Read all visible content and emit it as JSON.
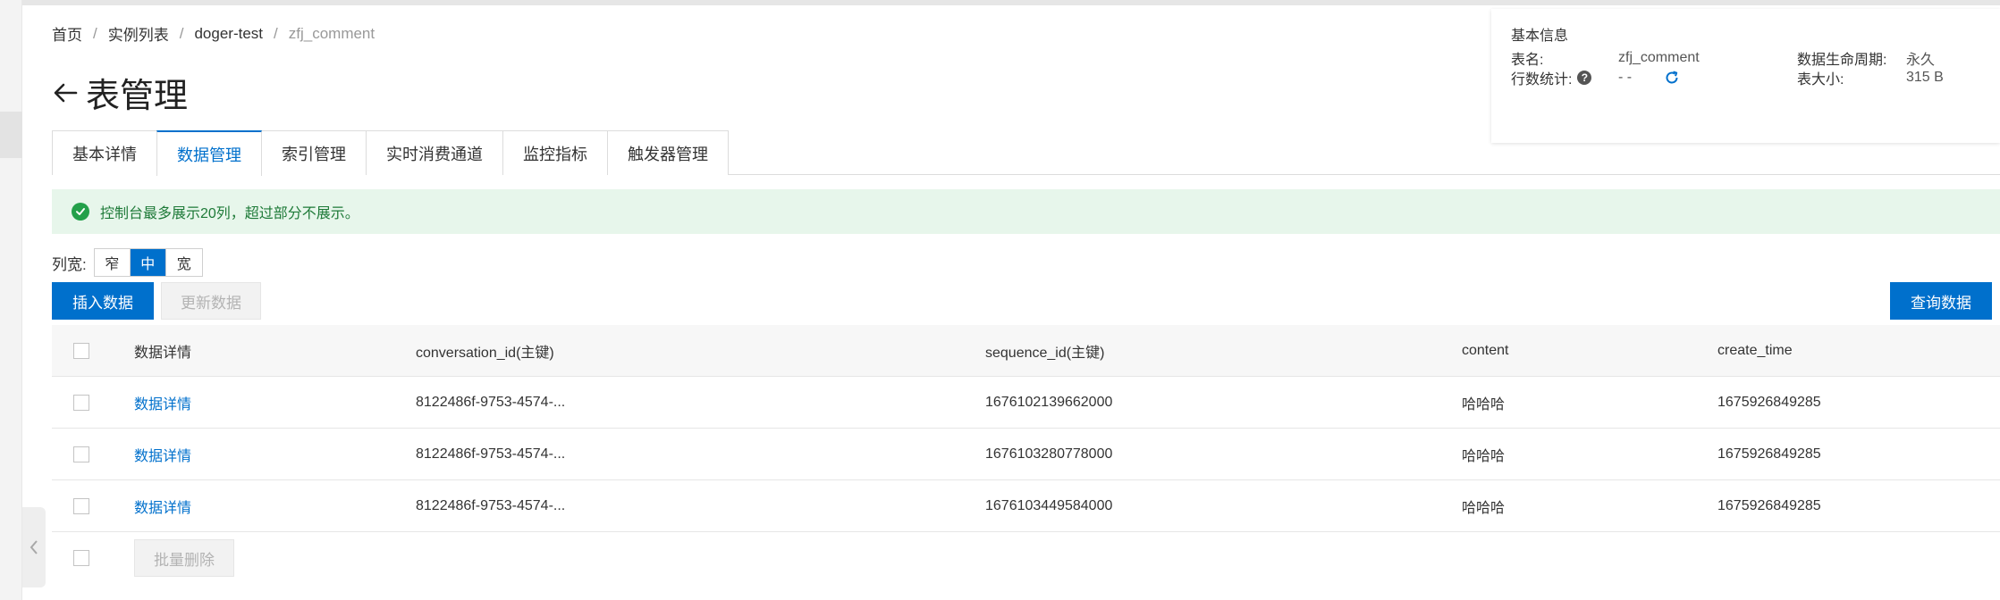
{
  "breadcrumb": {
    "items": [
      "首页",
      "实例列表",
      "doger-test"
    ],
    "separator": "/",
    "current": "zfj_comment"
  },
  "page": {
    "title": "表管理"
  },
  "info_panel": {
    "title": "基本信息",
    "table_name_label": "表名:",
    "table_name_value": "zfj_comment",
    "lifecycle_label": "数据生命周期:",
    "lifecycle_value": "永久",
    "row_count_label": "行数统计:",
    "row_count_value": "- -",
    "size_label": "表大小:",
    "size_value": "315 B"
  },
  "tabs": [
    {
      "label": "基本详情",
      "active": false
    },
    {
      "label": "数据管理",
      "active": true
    },
    {
      "label": "索引管理",
      "active": false
    },
    {
      "label": "实时消费通道",
      "active": false
    },
    {
      "label": "监控指标",
      "active": false
    },
    {
      "label": "触发器管理",
      "active": false
    }
  ],
  "alert": {
    "text": "控制台最多展示20列，超过部分不展示。"
  },
  "column_width": {
    "label": "列宽:",
    "options": [
      "窄",
      "中",
      "宽"
    ],
    "selected": "中"
  },
  "toolbar": {
    "insert_label": "插入数据",
    "update_label": "更新数据",
    "query_label": "查询数据"
  },
  "table": {
    "columns": [
      "数据详情",
      "conversation_id(主键)",
      "sequence_id(主键)",
      "content",
      "create_time"
    ],
    "rows": [
      {
        "detail": "数据详情",
        "conversation_id": "8122486f-9753-4574-...",
        "sequence_id": "1676102139662000",
        "content": "哈哈哈",
        "create_time": "1675926849285"
      },
      {
        "detail": "数据详情",
        "conversation_id": "8122486f-9753-4574-...",
        "sequence_id": "1676103280778000",
        "content": "哈哈哈",
        "create_time": "1675926849285"
      },
      {
        "detail": "数据详情",
        "conversation_id": "8122486f-9753-4574-...",
        "sequence_id": "1676103449584000",
        "content": "哈哈哈",
        "create_time": "1675926849285"
      }
    ],
    "batch_delete_label": "批量删除"
  },
  "colors": {
    "primary": "#0070cc",
    "success_bg": "#e7f6eb",
    "success_icon": "#23a04a"
  }
}
